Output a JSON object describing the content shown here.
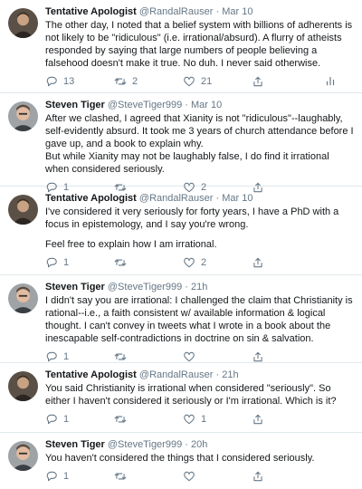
{
  "tweets": [
    {
      "author": "Tentative Apologist",
      "handle": "@RandalRauser",
      "sep": "·",
      "time": "Mar 10",
      "paragraphs": [
        "The other day, I noted that a belief system with billions of adherents is not likely to be \"ridiculous\" (i.e. irrational/absurd). A flurry of atheists responded by saying that large numbers of people believing a falsehood doesn't make it true. No duh. I never said otherwise."
      ],
      "replies": "13",
      "retweets": "2",
      "likes": "21"
    },
    {
      "author": "Steven Tiger",
      "handle": "@SteveTiger999",
      "sep": "·",
      "time": "Mar 10",
      "paragraphs": [
        "After we clashed, I agreed that Xianity is not \"ridiculous\"--laughably, self-evidently absurd. It took me 3 years of church attendance before I gave up, and a book to explain why.",
        "But while Xianity may not be laughably false, I do find it irrational when considered seriously."
      ],
      "replies": "1",
      "retweets": "",
      "likes": "2"
    },
    {
      "author": "Tentative Apologist",
      "handle": "@RandalRauser",
      "sep": "·",
      "time": "Mar 10",
      "paragraphs": [
        "I've considered it very seriously for forty years, I have a PhD with a focus in epistemology, and I say you're wrong.",
        "Feel free to explain how I am irrational."
      ],
      "replies": "1",
      "retweets": "",
      "likes": "2"
    },
    {
      "author": "Steven Tiger",
      "handle": "@SteveTiger999",
      "sep": "·",
      "time": "21h",
      "paragraphs": [
        "I didn't say you are irrational: I challenged the claim that Christianity is rational--i.e., a faith consistent w/ available information & logical thought. I can't convey in tweets what I wrote in a book about the inescapable self-contradictions in doctrine on sin & salvation."
      ],
      "replies": "1",
      "retweets": "",
      "likes": ""
    },
    {
      "author": "Tentative Apologist",
      "handle": "@RandalRauser",
      "sep": "·",
      "time": "21h",
      "paragraphs": [
        "You said Christianity is irrational when considered \"seriously\". So either I haven't considered it seriously or I'm irrational. Which is it?"
      ],
      "replies": "1",
      "retweets": "",
      "likes": "1"
    },
    {
      "author": "Steven Tiger",
      "handle": "@SteveTiger999",
      "sep": "·",
      "time": "20h",
      "paragraphs": [
        "You haven't considered the things that I considered seriously."
      ],
      "replies": "1",
      "retweets": "",
      "likes": ""
    }
  ],
  "icons": {
    "reply": "reply-icon",
    "retweet": "retweet-icon",
    "like": "heart-icon",
    "share": "share-icon",
    "stats": "analytics-icon"
  },
  "colors": {
    "text": "#14171a",
    "secondary": "#657786",
    "divider": "#e1e8ed"
  }
}
